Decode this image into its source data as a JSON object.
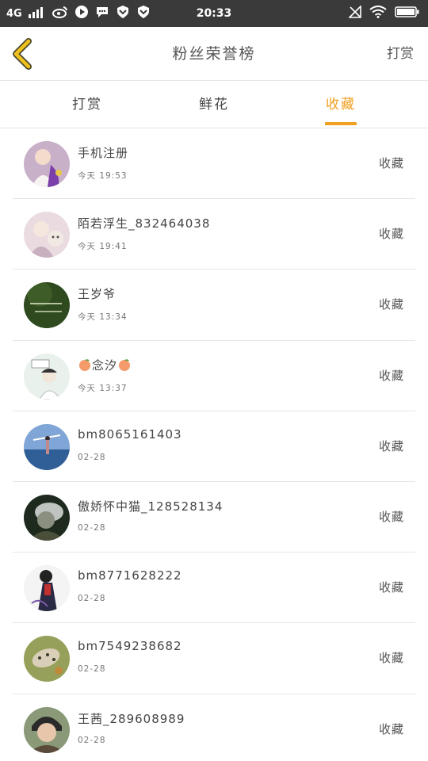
{
  "status_bar": {
    "network": "4G",
    "time": "20:33"
  },
  "header": {
    "title": "粉丝荣誉榜",
    "right_action": "打赏",
    "back_icon": "chevron-left-icon",
    "accent_color": "#f0a020"
  },
  "tabs": [
    {
      "label": "打赏",
      "active": false
    },
    {
      "label": "鲜花",
      "active": false
    },
    {
      "label": "收藏",
      "active": true
    }
  ],
  "rows": [
    {
      "name": "手机注册",
      "time": "今天 19:53",
      "action": "收藏",
      "avatar_color": "#b89ab8"
    },
    {
      "name": "陌若浮生_832464038",
      "time": "今天 19:41",
      "action": "收藏",
      "avatar_color": "#e6d2d6"
    },
    {
      "name": "王岁爷",
      "time": "今天 13:34",
      "action": "收藏",
      "avatar_color": "#2f4f1f"
    },
    {
      "name": "念汐",
      "time": "今天 13:37",
      "action": "收藏",
      "avatar_color": "#e8f0ea"
    },
    {
      "name": "bm8065161403",
      "time": "02-28",
      "action": "收藏",
      "avatar_color": "#4a7ab5"
    },
    {
      "name": "傲娇怀中猫_128528134",
      "time": "02-28",
      "action": "收藏",
      "avatar_color": "#3a3a30"
    },
    {
      "name": "bm8771628222",
      "time": "02-28",
      "action": "收藏",
      "avatar_color": "#f2f2f2"
    },
    {
      "name": "bm7549238682",
      "time": "02-28",
      "action": "收藏",
      "avatar_color": "#9aa060"
    },
    {
      "name": "王茜_289608989",
      "time": "02-28",
      "action": "收藏",
      "avatar_color": "#7a8a6a"
    }
  ]
}
